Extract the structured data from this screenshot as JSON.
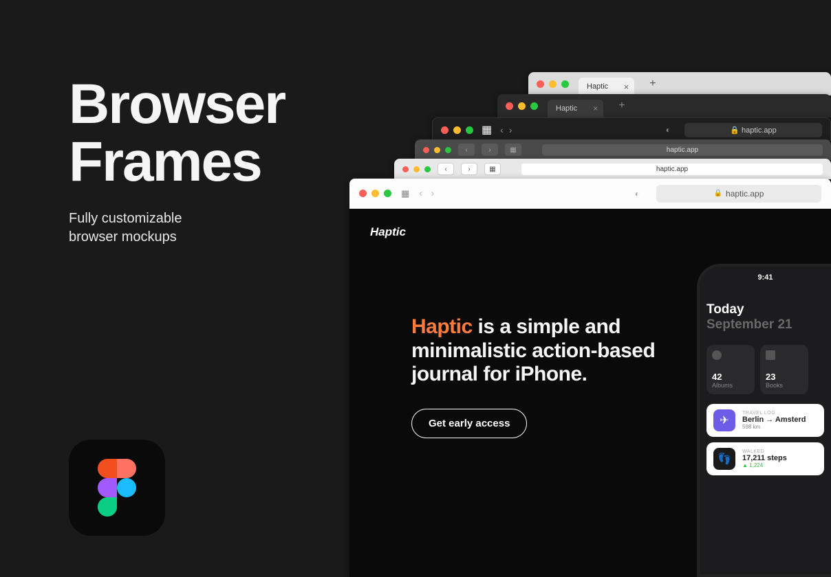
{
  "title_line1": "Browser",
  "title_line2": "Frames",
  "subtitle_line1": "Fully customizable",
  "subtitle_line2": "browser mockups",
  "windows": {
    "w1": {
      "tab": "Haptic",
      "close": "×",
      "plus": "+"
    },
    "w2": {
      "tab": "Haptic",
      "close": "×",
      "plus": "+"
    },
    "w3": {
      "url": "haptic.app",
      "lock": "🔒"
    },
    "w4": {
      "url": "haptic.app"
    },
    "w5": {
      "url": "haptic.app"
    },
    "w6": {
      "url": "haptic.app",
      "lock": "🔒"
    }
  },
  "page": {
    "logo": "Haptic",
    "hero_accent": "Haptic",
    "hero_rest": " is a simple and minimalistic action-based journal for iPhone.",
    "cta": "Get early access"
  },
  "phone": {
    "time": "9:41",
    "today": "Today",
    "date": "September 21",
    "tiles": [
      {
        "num": "42",
        "label": "Albums"
      },
      {
        "num": "23",
        "label": "Books"
      }
    ],
    "cards": [
      {
        "category": "TRAVEL LOG",
        "title": "Berlin → Amsterd",
        "sub": "598 km"
      },
      {
        "category": "WALKED",
        "title": "17,211 steps",
        "sub": "▲ 1,224"
      }
    ]
  }
}
